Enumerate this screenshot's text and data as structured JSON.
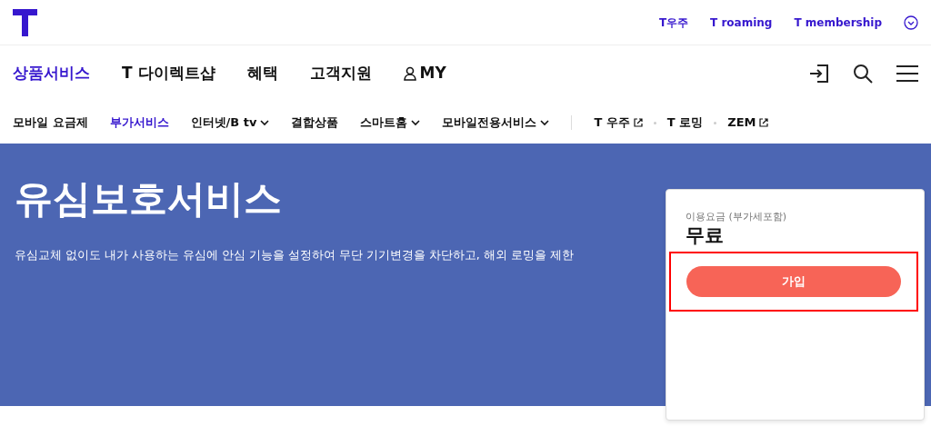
{
  "top_links": [
    {
      "label": "T우주"
    },
    {
      "label": "T roaming"
    },
    {
      "label": "T membership"
    }
  ],
  "main_nav": [
    {
      "label": "상품서비스",
      "selected": true,
      "kind": "text"
    },
    {
      "label": "T 다이렉트샵",
      "selected": false,
      "kind": "text"
    },
    {
      "label": "혜택",
      "selected": false,
      "kind": "text"
    },
    {
      "label": "고객지원",
      "selected": false,
      "kind": "text"
    },
    {
      "label": "MY",
      "selected": false,
      "kind": "person"
    }
  ],
  "sub_nav": [
    {
      "label": "모바일 요금제",
      "selected": false,
      "kind": "plain"
    },
    {
      "label": "부가서비스",
      "selected": true,
      "kind": "plain"
    },
    {
      "label": "인터넷/B tv",
      "selected": false,
      "kind": "dropdown"
    },
    {
      "label": "결합상품",
      "selected": false,
      "kind": "plain"
    },
    {
      "label": "스마트홈",
      "selected": false,
      "kind": "dropdown"
    },
    {
      "label": "모바일전용서비스",
      "selected": false,
      "kind": "dropdown"
    }
  ],
  "external_links": [
    {
      "label": "T 우주",
      "kind": "external"
    },
    {
      "label": "T 로밍",
      "kind": "plain"
    },
    {
      "label": "ZEM",
      "kind": "external"
    }
  ],
  "hero": {
    "title": "유심보호서비스",
    "description": "유심교체 없이도 내가 사용하는 유심에 안심 기능을 설정하여 무단 기기변경을 차단하고, 해외 로밍을 제한"
  },
  "price_card": {
    "label": "이용요금 (부가세포함)",
    "price": "무료",
    "button": {
      "label": "가입",
      "highlighted": true
    }
  }
}
